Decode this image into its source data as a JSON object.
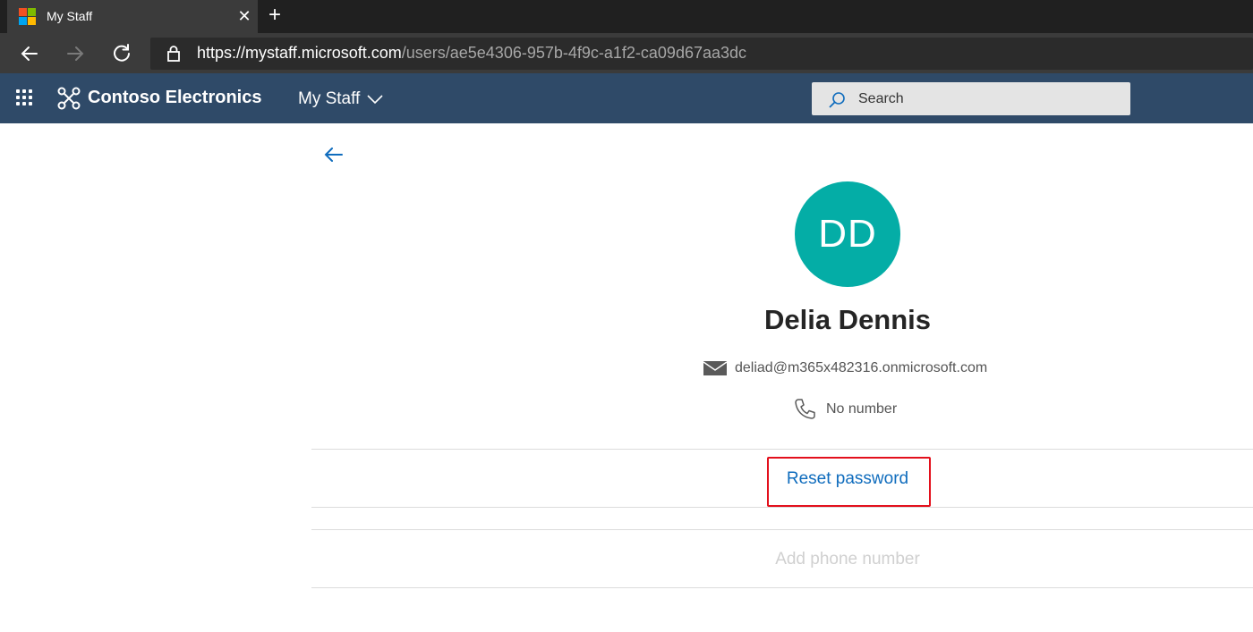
{
  "browser": {
    "tab_title": "My Staff",
    "tab_close": "✕",
    "new_tab": "+",
    "url_main": "https://mystaff.microsoft.com",
    "url_path": "/users/ae5e4306-957b-4f9c-a1f2-ca09d67aa3dc",
    "ms_logo_colors": [
      "#f25022",
      "#7fba00",
      "#00a4ef",
      "#ffb900"
    ]
  },
  "header": {
    "brand": "Contoso Electronics",
    "app_name": "My Staff",
    "search_placeholder": "Search",
    "background": "#2f4a68"
  },
  "profile": {
    "initials": "DD",
    "avatar_color": "#04ada6",
    "name": "Delia Dennis",
    "email": "deliad@m365x482316.onmicrosoft.com",
    "phone": "No number"
  },
  "actions": {
    "reset_password": "Reset password",
    "add_phone": "Add phone number"
  },
  "icons": [
    "waffle-icon",
    "contoso-logo-icon",
    "chevron-down-icon",
    "search-icon",
    "back-arrow-icon",
    "mail-icon",
    "phone-icon",
    "lock-icon",
    "refresh-icon"
  ]
}
